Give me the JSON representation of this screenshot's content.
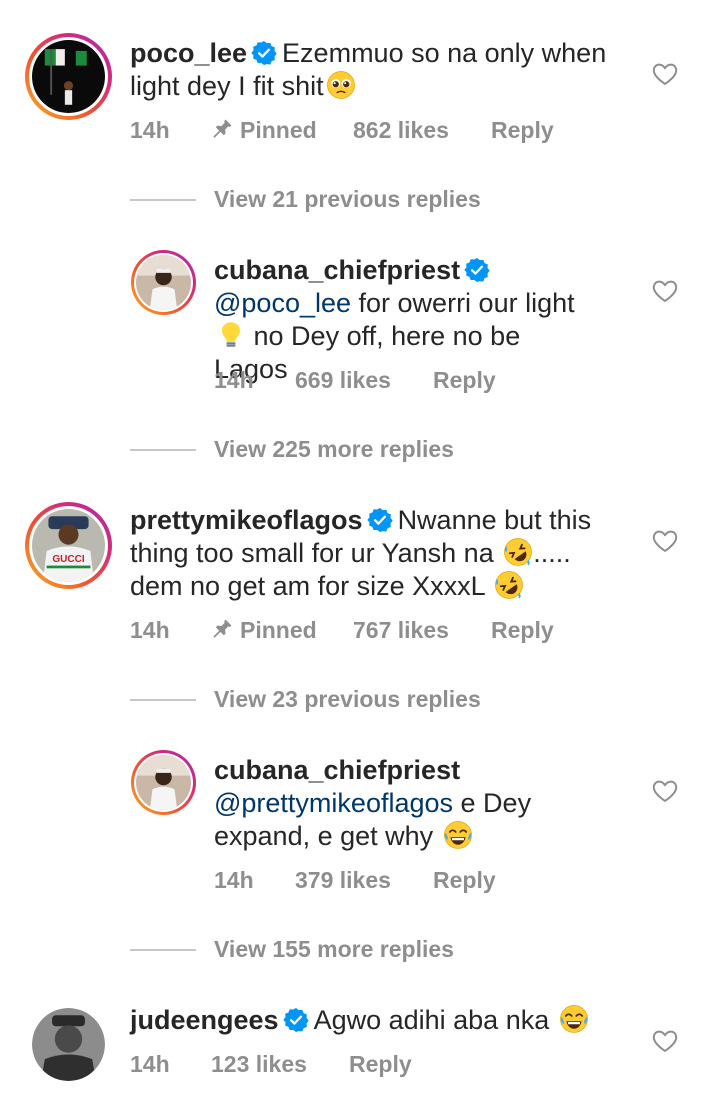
{
  "comments": [
    {
      "username": "poco_lee",
      "text": "Ezemmuo so na only when light dey I fit shit",
      "time": "14h",
      "pinned": "Pinned",
      "likes": "862 likes",
      "reply": "Reply"
    },
    {
      "view_replies": "View 21 previous replies"
    },
    {
      "username": "cubana_chiefpriest",
      "mention": "@poco_lee",
      "text_a": "for owerri our light",
      "text_b": "no Dey off, here no be Lagos",
      "time": "14h",
      "likes": "669 likes",
      "reply": "Reply"
    },
    {
      "view_replies": "View 225 more replies"
    },
    {
      "username": "prettymikeoflagos",
      "text_a": "Nwanne but this thing too small for ur Yansh na",
      "text_b": "..... dem no get am for size XxxxL",
      "time": "14h",
      "pinned": "Pinned",
      "likes": "767 likes",
      "reply": "Reply"
    },
    {
      "view_replies": "View 23 previous replies"
    },
    {
      "username": "cubana_chiefpriest",
      "mention": "@prettymikeoflagos",
      "text": "e Dey expand, e get why",
      "time": "14h",
      "likes": "379 likes",
      "reply": "Reply"
    },
    {
      "view_replies": "View 155 more replies"
    },
    {
      "username": "judeengees",
      "text": "Agwo adihi aba nka",
      "time": "14h",
      "likes": "123 likes",
      "reply": "Reply"
    }
  ],
  "icons": {
    "verified": "verified-badge-icon",
    "heart": "heart-outline-icon",
    "pin": "pin-icon"
  },
  "colors": {
    "verified_blue": "#0095f6",
    "mention": "#00376b",
    "meta_gray": "#8e8e8e"
  }
}
